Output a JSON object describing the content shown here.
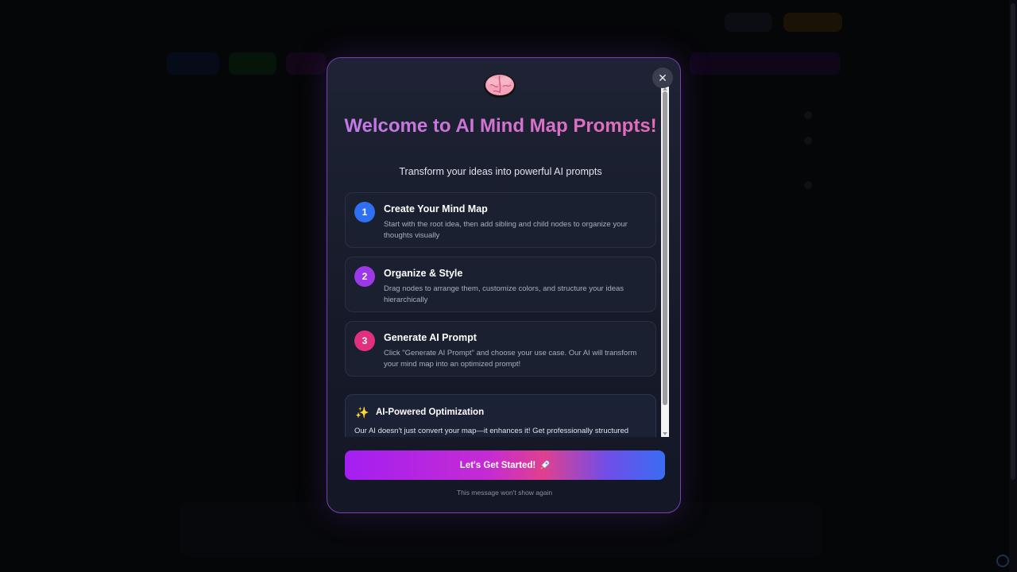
{
  "modal": {
    "title": "Welcome to AI Mind Map Prompts!",
    "subtitle": "Transform your ideas into powerful AI prompts",
    "close_icon": "close-icon",
    "steps": [
      {
        "number": "1",
        "title": "Create Your Mind Map",
        "description": "Start with the root idea, then add sibling and child nodes to organize your thoughts visually",
        "color": "#2f6ff2"
      },
      {
        "number": "2",
        "title": "Organize & Style",
        "description": "Drag nodes to arrange them, customize colors, and structure your ideas hierarchically",
        "color": "#9d38e8"
      },
      {
        "number": "3",
        "title": "Generate AI Prompt",
        "description": "Click \"Generate AI Prompt\" and choose your use case. Our AI will transform your mind map into an optimized prompt!",
        "color": "#e0307f"
      }
    ],
    "ai_box": {
      "title": "AI-Powered Optimization",
      "description": "Our AI doesn't just convert your map—it enhances it! Get professionally structured"
    },
    "cta": {
      "label": "Let's Get Started!",
      "icon": "rocket-icon"
    },
    "footnote": "This message won't show again"
  },
  "colors": {
    "modal_border": "#7b3fb5",
    "title_gradient_start": "#c17ae8",
    "title_gradient_end": "#e56bb8"
  }
}
